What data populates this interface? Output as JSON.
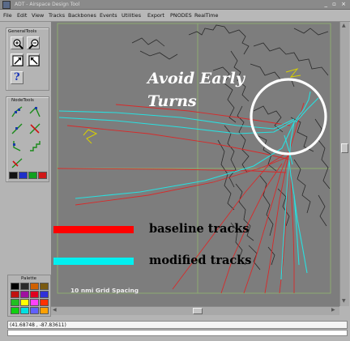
{
  "window": {
    "title": "ADT - Airspace Design Tool",
    "controls": "_ ▫ ×"
  },
  "menu": [
    "File",
    "Edit",
    "View",
    "Tracks",
    "Backbones",
    "Events",
    "Utilities",
    "Export",
    "PNODES",
    "RealTime"
  ],
  "tool_panel": {
    "general_label": "GeneralTools",
    "node_label": "NodeTools",
    "help_glyph": "?",
    "color_buttons": [
      "#111111",
      "#2030c8",
      "#10a020",
      "#d01818"
    ]
  },
  "palette": {
    "label": "Palette",
    "colors": [
      "#000000",
      "#2a2a2a",
      "#d06000",
      "#7a5a10",
      "#c01010",
      "#a010a0",
      "#e00020",
      "#3030d8",
      "#20c020",
      "#ffff00",
      "#ff40ff",
      "#ff3000",
      "#10d010",
      "#00e0e0",
      "#6060ff",
      "#ffa000"
    ]
  },
  "map": {
    "grid_note": "10 nmi Grid Spacing",
    "annotation_line1": "Avoid Early",
    "annotation_line2": "Turns",
    "legend": {
      "baseline_label": "baseline tracks",
      "modified_label": "modified tracks",
      "baseline_color": "#ff0000",
      "modified_color": "#00f0f0"
    }
  },
  "status": {
    "coordinates": "(41.68748 , -87.83611)"
  }
}
